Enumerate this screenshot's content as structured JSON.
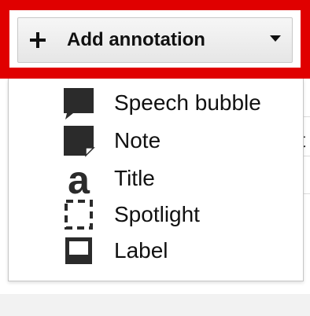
{
  "add_annotation": {
    "label": "Add annotation",
    "plus_icon": "plus-icon",
    "caret_icon": "caret-down-icon"
  },
  "menu": {
    "items": [
      {
        "label": "Speech bubble",
        "icon": "speech-bubble-icon"
      },
      {
        "label": "Note",
        "icon": "note-icon"
      },
      {
        "label": "Title",
        "icon": "title-icon"
      },
      {
        "label": "Spotlight",
        "icon": "spotlight-icon"
      },
      {
        "label": "Label",
        "icon": "label-icon"
      }
    ]
  },
  "background": {
    "partial_glyph": "t"
  },
  "colors": {
    "highlight": "#e00000",
    "icon": "#2b2b2b",
    "text": "#111111"
  }
}
